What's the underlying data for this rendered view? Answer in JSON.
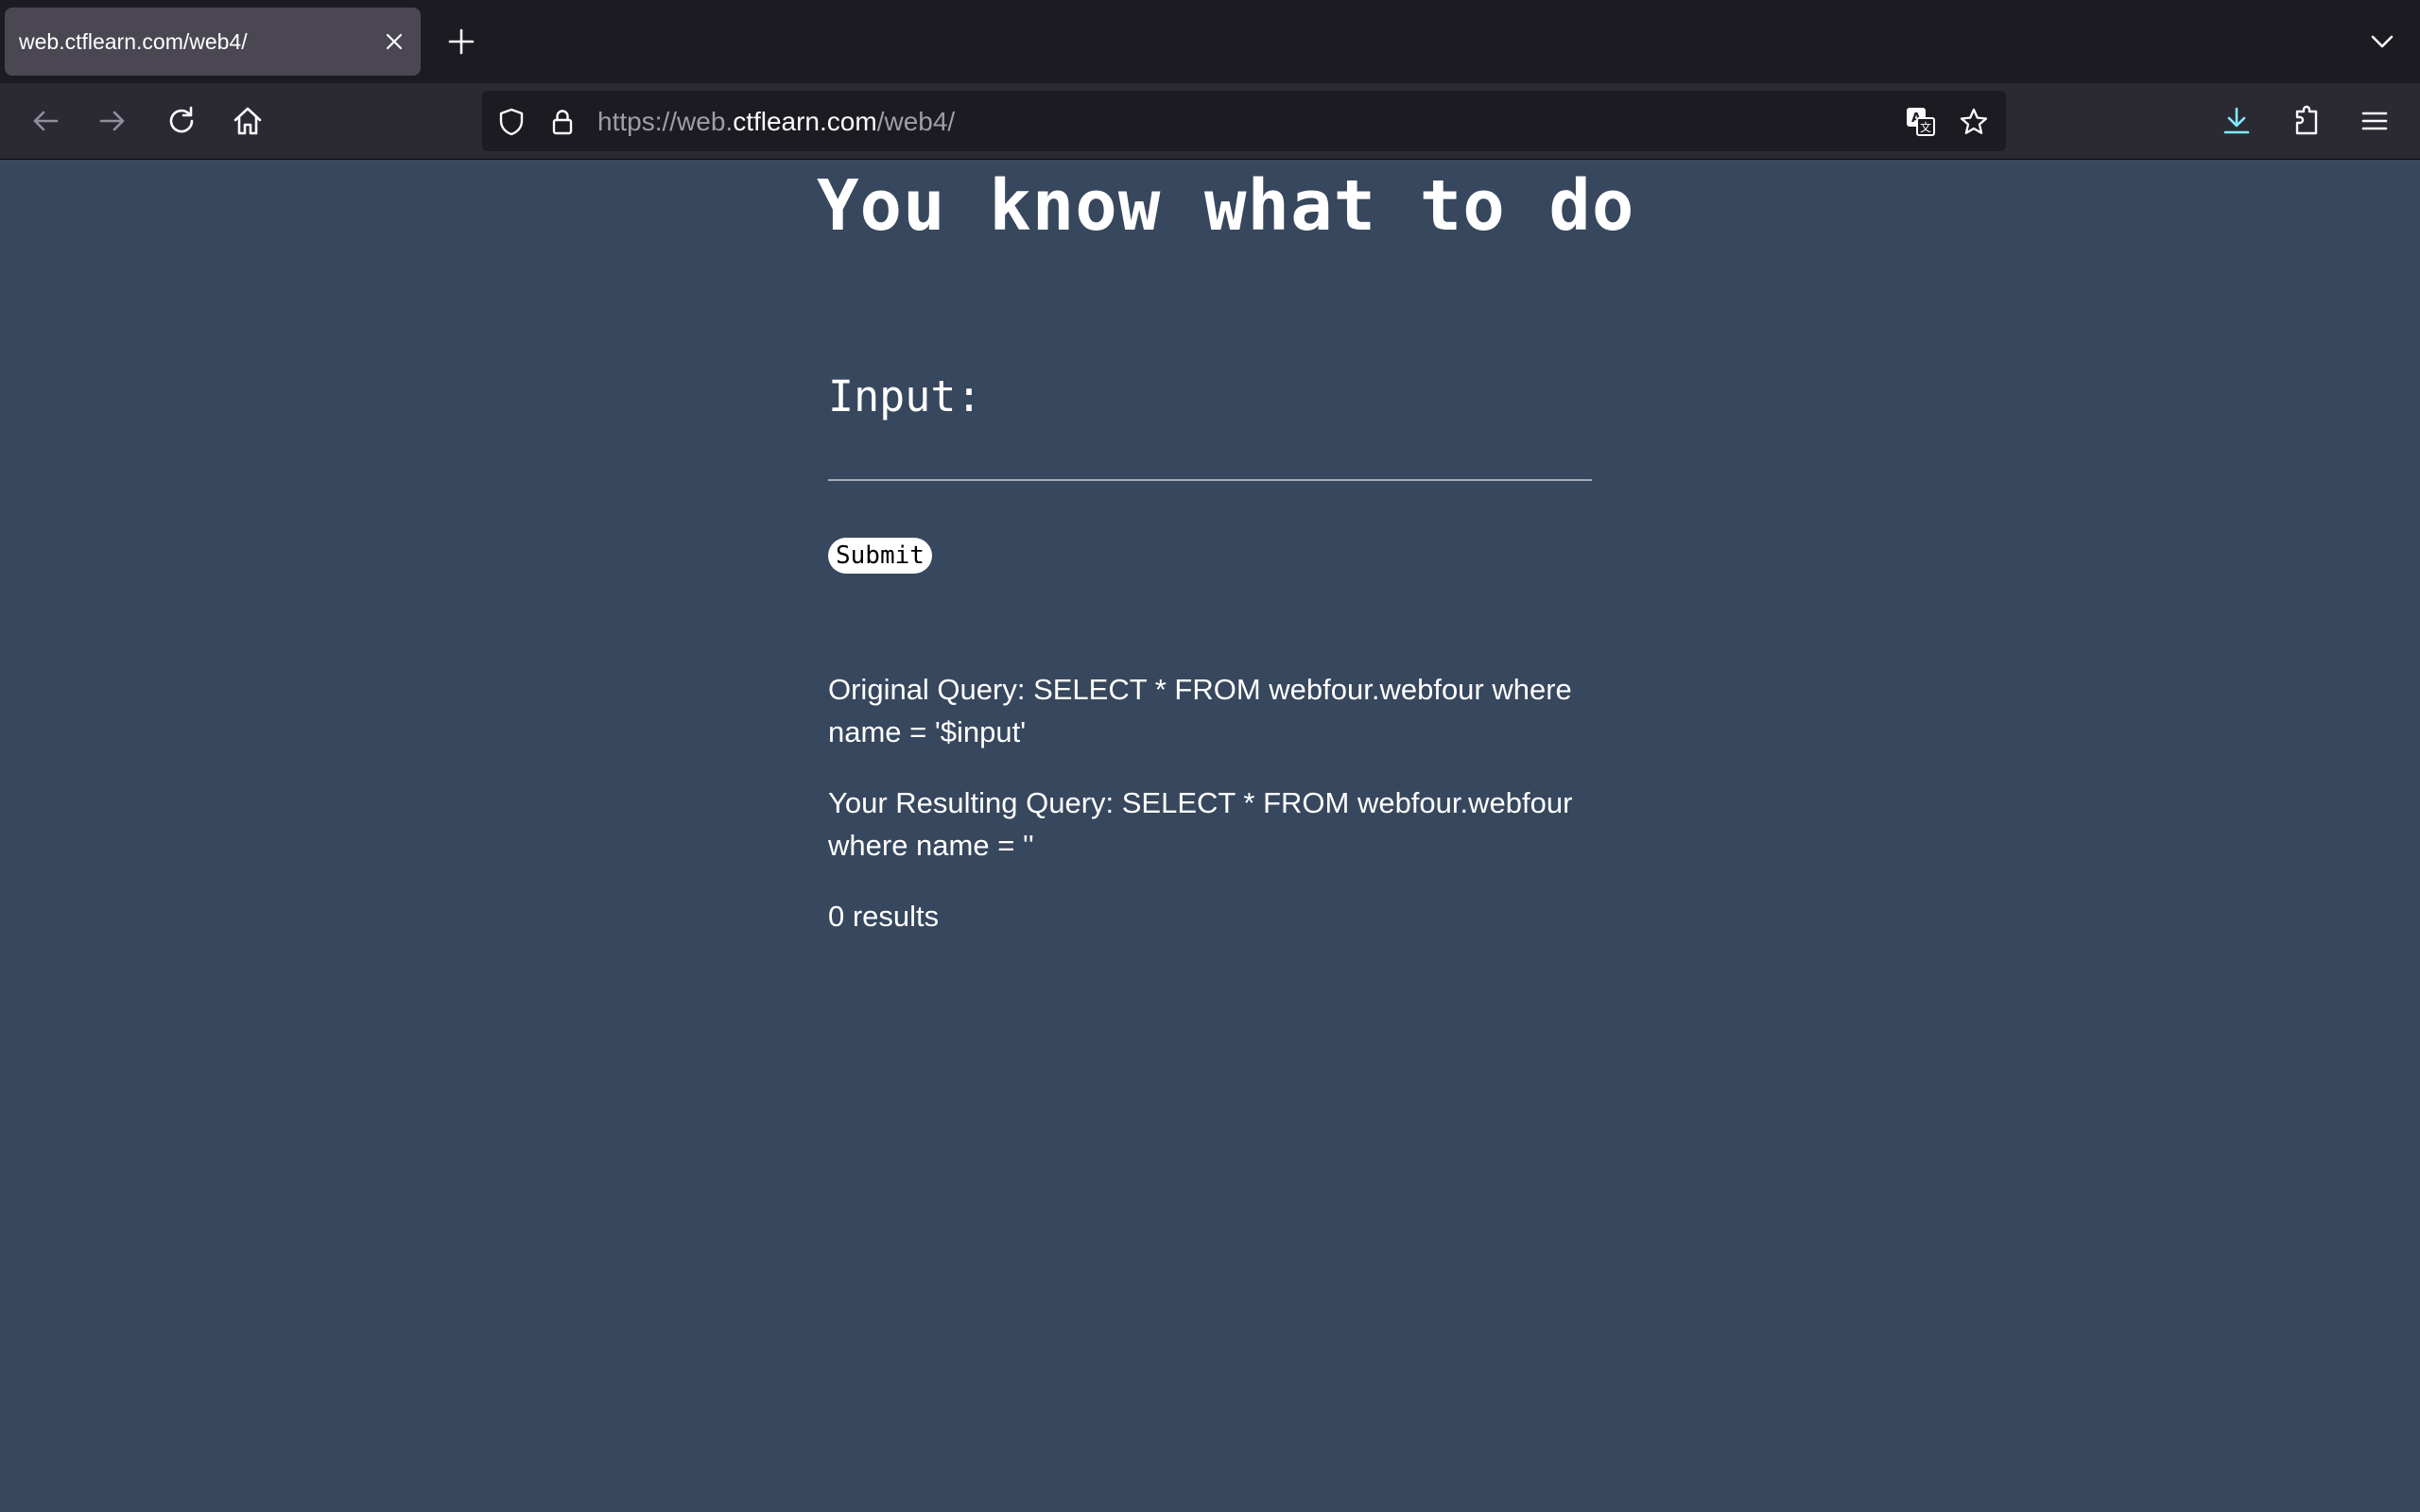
{
  "browser": {
    "tab_title": "web.ctflearn.com/web4/",
    "url_prefix": "https://web.",
    "url_host": "ctflearn.com",
    "url_path": "/web4/",
    "icons": [
      "close-icon",
      "plus-icon",
      "chevron-down-icon",
      "back-arrow-icon",
      "forward-arrow-icon",
      "reload-icon",
      "home-icon",
      "shield-icon",
      "lock-icon",
      "translate-icon",
      "star-icon",
      "download-icon",
      "extensions-icon",
      "menu-icon"
    ],
    "accent_color": "#54ffbd",
    "download_color": "#80ebff"
  },
  "page": {
    "heading": "You know what to do",
    "input_label": "Input:",
    "input_value": "",
    "submit_label": "Submit",
    "original_query": "Original Query: SELECT * FROM webfour.webfour where name = '$input'",
    "resulting_query": "Your Resulting Query: SELECT * FROM webfour.webfour where name = ''",
    "results": "0 results",
    "background_color": "#37475d"
  }
}
